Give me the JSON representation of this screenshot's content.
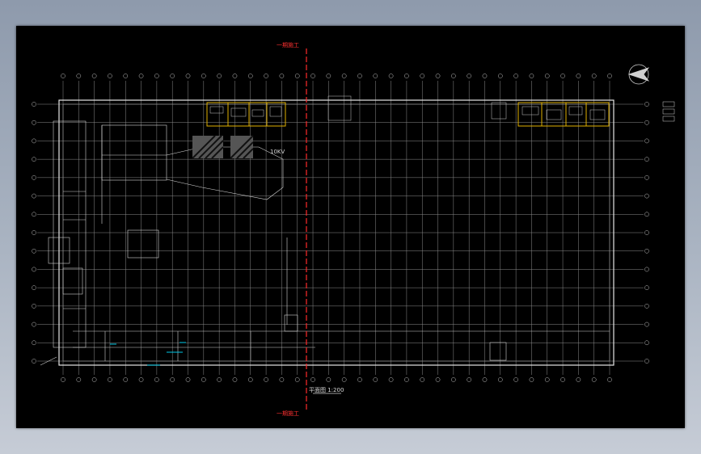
{
  "window": {
    "background": "#9aa5b4",
    "sheet_background": "#000000"
  },
  "drawing": {
    "section_label_top": "一期施工",
    "section_label_bottom": "一期施工",
    "scale_label": "平面图 1:200",
    "room_label": "10KV"
  },
  "colors": {
    "grid": "#8c8c8c",
    "walls": "#e6e6e6",
    "section_line": "#ff2a2a",
    "highlight": "#e0b000",
    "equipment": "#00c8e6"
  }
}
